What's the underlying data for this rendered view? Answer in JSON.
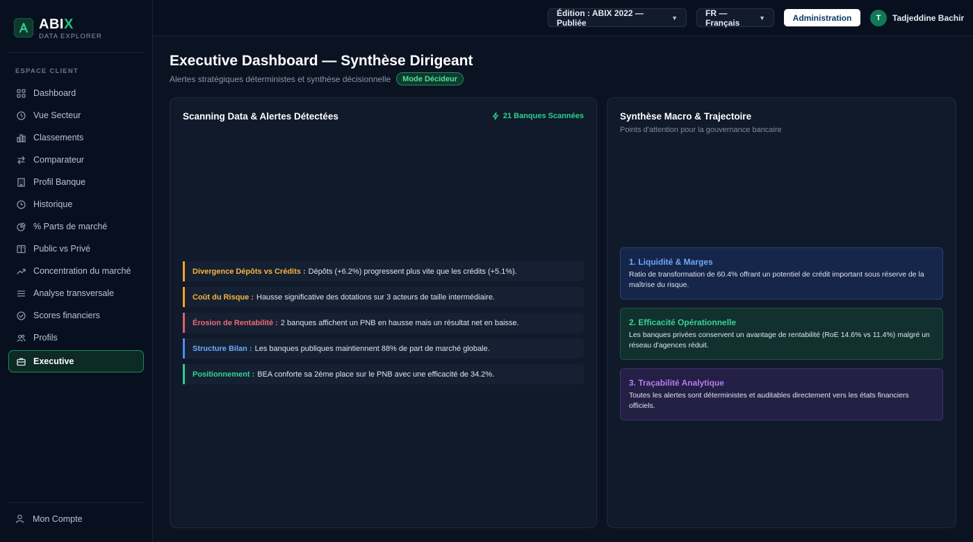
{
  "brand": {
    "name_main": "ABI",
    "name_accent": "X",
    "subtitle": "DATA EXPLORER"
  },
  "sidebar": {
    "section_label": "ESPACE CLIENT",
    "items": [
      {
        "label": "Dashboard",
        "icon": "grid-icon"
      },
      {
        "label": "Vue Secteur",
        "icon": "clock-icon"
      },
      {
        "label": "Classements",
        "icon": "bar-chart-icon"
      },
      {
        "label": "Comparateur",
        "icon": "arrows-swap-icon"
      },
      {
        "label": "Profil Banque",
        "icon": "building-icon"
      },
      {
        "label": "Historique",
        "icon": "history-icon"
      },
      {
        "label": "% Parts de marché",
        "icon": "pie-chart-icon"
      },
      {
        "label": "Public vs Privé",
        "icon": "columns-icon"
      },
      {
        "label": "Concentration du marché",
        "icon": "trend-icon"
      },
      {
        "label": "Analyse transversale",
        "icon": "list-icon"
      },
      {
        "label": "Scores financiers",
        "icon": "check-circle-icon"
      },
      {
        "label": "Profils",
        "icon": "users-icon"
      },
      {
        "label": "Executive",
        "icon": "briefcase-icon",
        "active": true
      }
    ],
    "account_label": "Mon Compte"
  },
  "topbar": {
    "edition": "Édition : ABIX 2022 — Publiée",
    "language": "FR — Français",
    "admin_label": "Administration",
    "user_initial": "T",
    "user_name": "Tadjeddine Bachir"
  },
  "header": {
    "title": "Executive Dashboard — Synthèse Dirigeant",
    "subtitle": "Alertes stratégiques déterministes et synthèse décisionnelle",
    "mode_badge": "Mode Décideur"
  },
  "scanning": {
    "title": "Scanning Data & Alertes Détectées",
    "badge": "21 Banques Scannées",
    "alerts": [
      {
        "label": "Divergence Dépôts vs Crédits :",
        "text": "Dépôts (+6.2%) progressent plus vite que les crédits (+5.1%).",
        "color": "orange"
      },
      {
        "label": "Coût du Risque :",
        "text": "Hausse significative des dotations sur 3 acteurs de taille intermédiaire.",
        "color": "orange"
      },
      {
        "label": "Érosion de Rentabilité :",
        "text": "2 banques affichent un PNB en hausse mais un résultat net en baisse.",
        "color": "red"
      },
      {
        "label": "Structure Bilan :",
        "text": "Les banques publiques maintiennent 88% de part de marché globale.",
        "color": "blue"
      },
      {
        "label": "Positionnement :",
        "text": "BEA conforte sa 2ème place sur le PNB avec une efficacité de 34.2%.",
        "color": "green"
      }
    ]
  },
  "synthese": {
    "title": "Synthèse Macro & Trajectoire",
    "subtitle": "Points d'attention pour la gouvernance bancaire",
    "insights": [
      {
        "title": "1. Liquidité & Marges",
        "text": "Ratio de transformation de 60.4% offrant un potentiel de crédit important sous réserve de la maîtrise du risque.",
        "color": "blue"
      },
      {
        "title": "2. Efficacité Opérationnelle",
        "text": "Les banques privées conservent un avantage de rentabilité (RoE 14.6% vs 11.4%) malgré un réseau d'agences réduit.",
        "color": "green"
      },
      {
        "title": "3. Traçabilité Analytique",
        "text": "Toutes les alertes sont déterministes et auditables directement vers les états financiers officiels.",
        "color": "purple"
      }
    ]
  }
}
